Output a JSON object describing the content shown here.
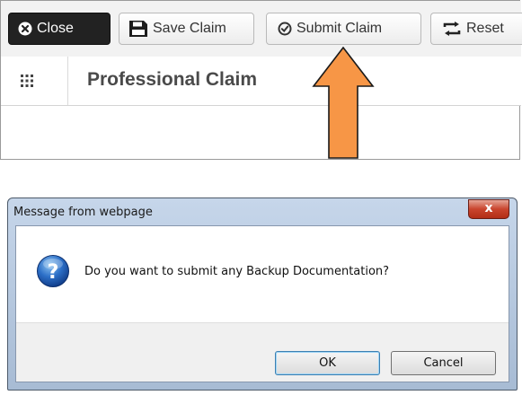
{
  "toolbar": {
    "close_label": "Close",
    "save_label": "Save Claim",
    "submit_label": "Submit Claim",
    "reset_label": "Reset"
  },
  "form": {
    "title": "Professional Claim"
  },
  "annotation": {
    "arrow_color": "#f79646"
  },
  "dialog": {
    "title": "Message from webpage",
    "close_glyph": "x",
    "message": "Do you want to submit any Backup Documentation?",
    "ok_label": "OK",
    "cancel_label": "Cancel"
  },
  "icons": [
    "close-circle-icon",
    "save-icon",
    "check-circle-icon",
    "reset-icon",
    "grid-icon",
    "question-icon",
    "arrow-up-icon"
  ]
}
